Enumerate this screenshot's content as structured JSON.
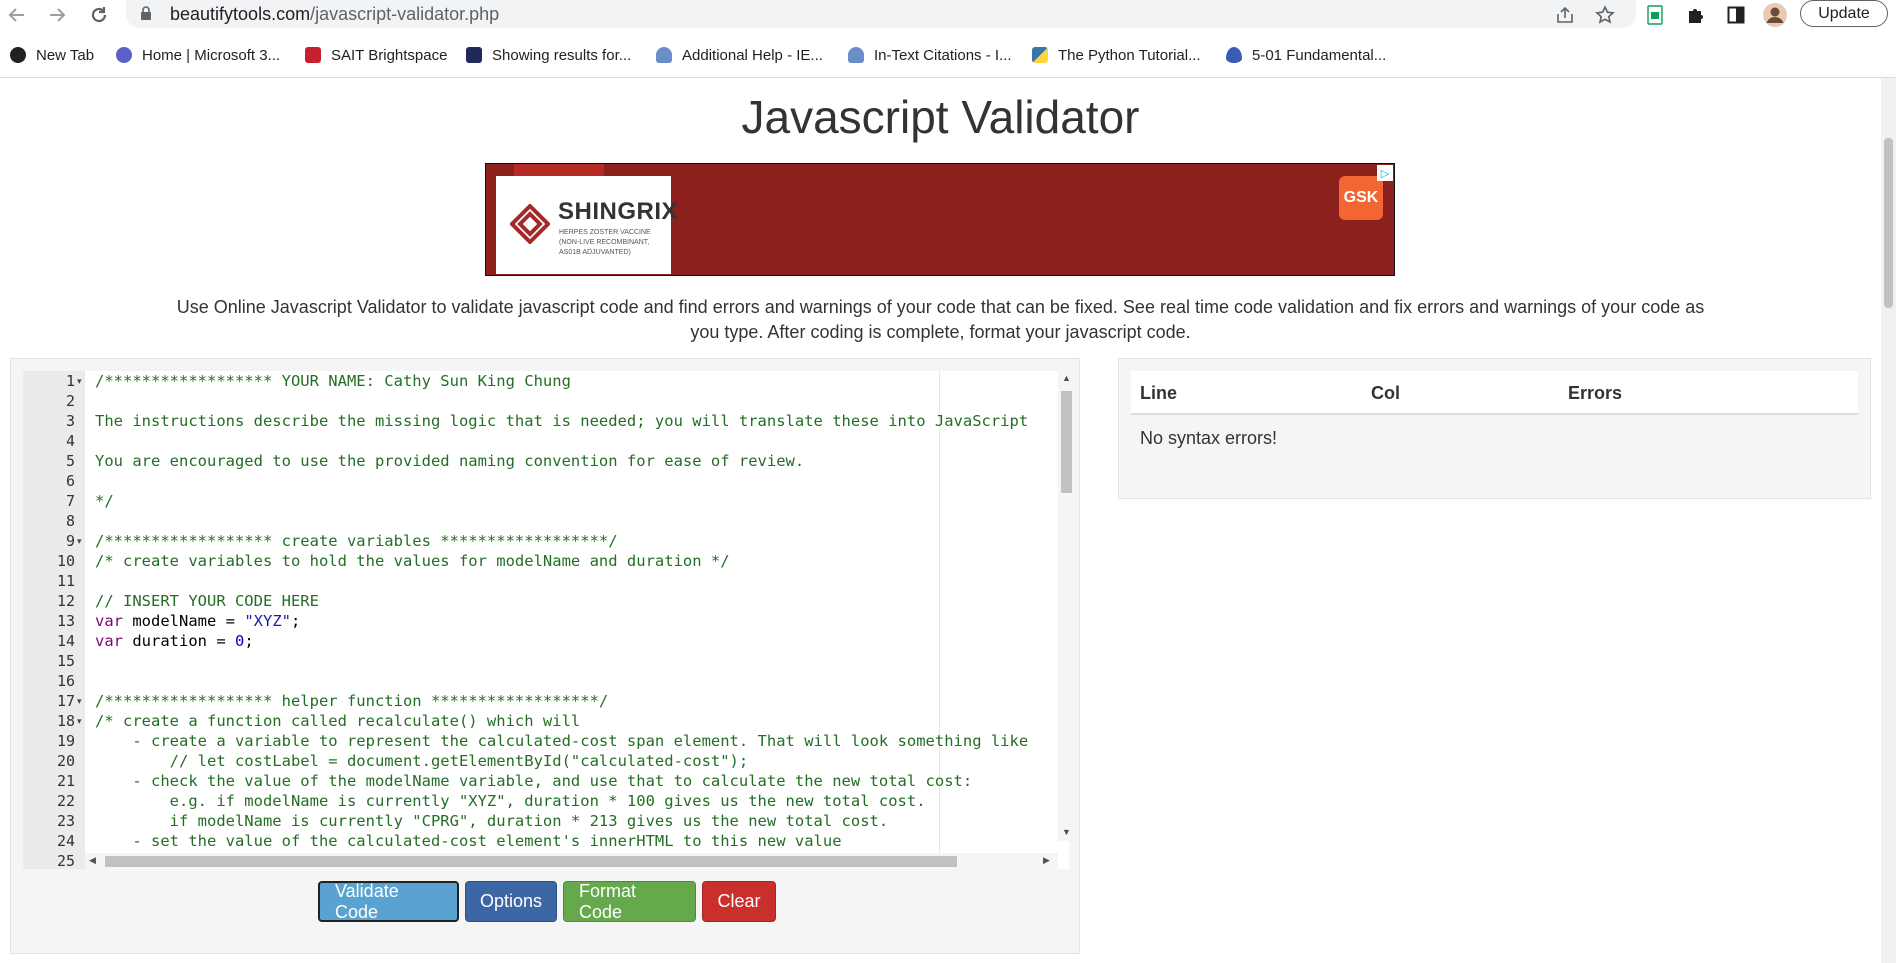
{
  "browser": {
    "url_host": "beautifytools.com",
    "url_path": "/javascript-validator.php",
    "update_label": "Update",
    "bookmarks": [
      {
        "label": "New Tab",
        "icon": "globe-icon",
        "color": "#202124"
      },
      {
        "label": "Home | Microsoft 3...",
        "icon": "microsoft-365-icon",
        "color": "#5b5fc7"
      },
      {
        "label": "SAIT Brightspace",
        "icon": "brightspace-icon",
        "color": "#c7202c"
      },
      {
        "label": "Showing results for...",
        "icon": "search-icon",
        "color": "#1f2a5a"
      },
      {
        "label": "Additional Help - IE...",
        "icon": "cloud-icon",
        "color": "#6a8ec7"
      },
      {
        "label": "In-Text Citations - I...",
        "icon": "cloud-icon",
        "color": "#6a8ec7"
      },
      {
        "label": "The Python Tutorial...",
        "icon": "python-icon",
        "color": "#3776ab"
      },
      {
        "label": "5-01 Fundamental...",
        "icon": "flame-icon",
        "color": "#3a5bb5"
      }
    ]
  },
  "page": {
    "title": "Javascript Validator",
    "intro": "Use Online Javascript Validator to validate javascript code and find errors and warnings of your code that can be fixed. See real time code validation and fix errors and warnings of your code as you type. After coding is complete, format your javascript code."
  },
  "ad": {
    "brand": "SHINGRIX",
    "subtitle": "HERPES ZOSTER VACCINE (NON-LIVE RECOMBINANT, AS01B ADJUVANTED)",
    "sponsor": "GSK"
  },
  "editor": {
    "lines": [
      {
        "n": "1",
        "fold": true,
        "text": "/****************** YOUR NAME: Cathy Sun King Chung",
        "type": "comment"
      },
      {
        "n": "2",
        "fold": false,
        "text": "",
        "type": "comment"
      },
      {
        "n": "3",
        "fold": false,
        "text": "The instructions describe the missing logic that is needed; you will translate these into JavaScript",
        "type": "comment"
      },
      {
        "n": "4",
        "fold": false,
        "text": "",
        "type": "comment"
      },
      {
        "n": "5",
        "fold": false,
        "text": "You are encouraged to use the provided naming convention for ease of review.",
        "type": "comment"
      },
      {
        "n": "6",
        "fold": false,
        "text": "",
        "type": "comment"
      },
      {
        "n": "7",
        "fold": false,
        "text": "*/",
        "type": "comment"
      },
      {
        "n": "8",
        "fold": false,
        "text": "",
        "type": "comment"
      },
      {
        "n": "9",
        "fold": true,
        "text": "/****************** create variables ******************/",
        "type": "comment"
      },
      {
        "n": "10",
        "fold": false,
        "text": "/* create variables to hold the values for modelName and duration */",
        "type": "comment"
      },
      {
        "n": "11",
        "fold": false,
        "text": "",
        "type": "comment"
      },
      {
        "n": "12",
        "fold": false,
        "text": "// INSERT YOUR CODE HERE",
        "type": "comment"
      },
      {
        "n": "13",
        "fold": false,
        "text": "var modelName = \"XYZ\";",
        "type": "code",
        "parts": [
          {
            "t": "var",
            "c": "k"
          },
          {
            "t": " modelName = ",
            "c": ""
          },
          {
            "t": "\"XYZ\"",
            "c": "s"
          },
          {
            "t": ";",
            "c": ""
          }
        ]
      },
      {
        "n": "14",
        "fold": false,
        "text": "var duration = 0;",
        "type": "code",
        "parts": [
          {
            "t": "var",
            "c": "k"
          },
          {
            "t": " duration = ",
            "c": ""
          },
          {
            "t": "0",
            "c": "n"
          },
          {
            "t": ";",
            "c": ""
          }
        ]
      },
      {
        "n": "15",
        "fold": false,
        "text": "",
        "type": "comment"
      },
      {
        "n": "16",
        "fold": false,
        "text": "",
        "type": "comment"
      },
      {
        "n": "17",
        "fold": true,
        "text": "/****************** helper function ******************/",
        "type": "comment"
      },
      {
        "n": "18",
        "fold": true,
        "text": "/* create a function called recalculate() which will",
        "type": "comment"
      },
      {
        "n": "19",
        "fold": false,
        "text": "    - create a variable to represent the calculated-cost span element. That will look something like",
        "type": "comment"
      },
      {
        "n": "20",
        "fold": false,
        "text": "        // let costLabel = document.getElementById(\"calculated-cost\");",
        "type": "comment"
      },
      {
        "n": "21",
        "fold": false,
        "text": "    - check the value of the modelName variable, and use that to calculate the new total cost:",
        "type": "comment"
      },
      {
        "n": "22",
        "fold": false,
        "text": "        e.g. if modelName is currently \"XYZ\", duration * 100 gives us the new total cost.",
        "type": "comment"
      },
      {
        "n": "23",
        "fold": false,
        "text": "        if modelName is currently \"CPRG\", duration * 213 gives us the new total cost.",
        "type": "comment"
      },
      {
        "n": "24",
        "fold": false,
        "text": "    - set the value of the calculated-cost element's innerHTML to this new value",
        "type": "comment"
      },
      {
        "n": "25",
        "fold": false,
        "text": "",
        "type": "comment"
      }
    ]
  },
  "buttons": {
    "validate": "Validate Code",
    "options": "Options",
    "format": "Format Code",
    "clear": "Clear"
  },
  "errors": {
    "col_line": "Line",
    "col_col": "Col",
    "col_errors": "Errors",
    "message": "No syntax errors!"
  }
}
